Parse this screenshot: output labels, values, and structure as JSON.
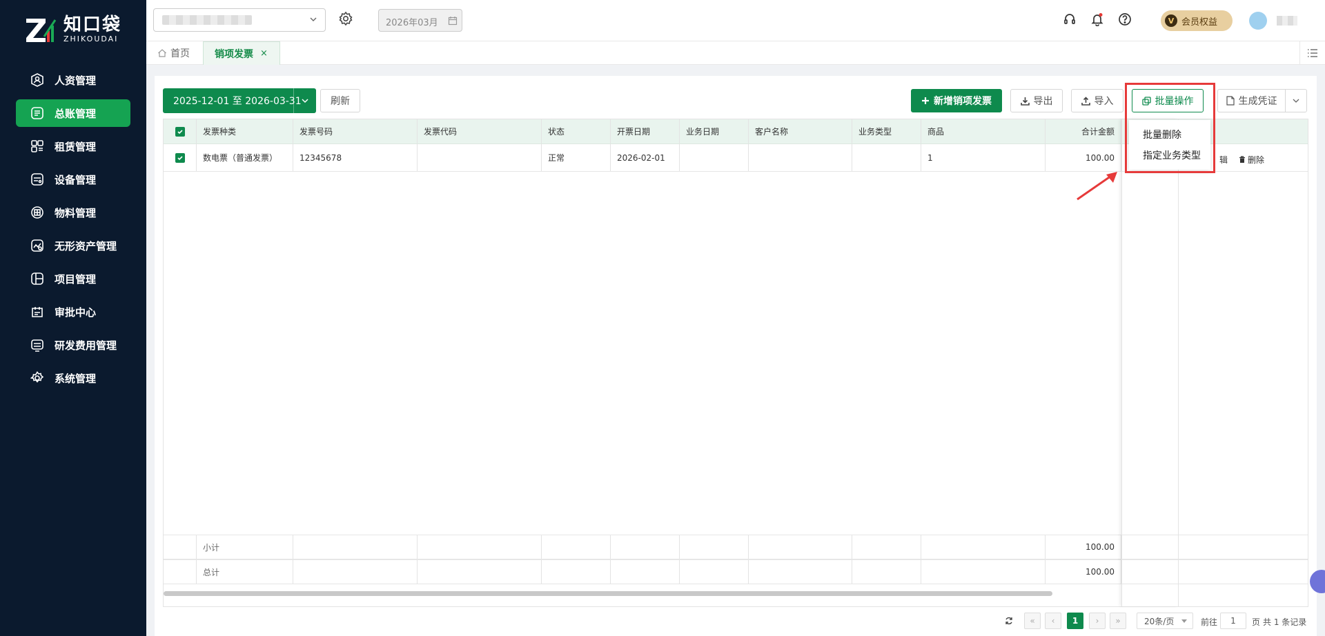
{
  "logo": {
    "cn": "知口袋",
    "en": "ZHIKOUDAI"
  },
  "sidebar": {
    "items": [
      {
        "label": "人资管理",
        "icon": "user-circle-icon",
        "active": false
      },
      {
        "label": "总账管理",
        "icon": "ledger-icon",
        "active": true
      },
      {
        "label": "租赁管理",
        "icon": "lease-icon",
        "active": false
      },
      {
        "label": "设备管理",
        "icon": "device-icon",
        "active": false
      },
      {
        "label": "物料管理",
        "icon": "material-icon",
        "active": false
      },
      {
        "label": "无形资产管理",
        "icon": "intangible-asset-icon",
        "active": false
      },
      {
        "label": "项目管理",
        "icon": "project-icon",
        "active": false
      },
      {
        "label": "审批中心",
        "icon": "approval-icon",
        "active": false
      },
      {
        "label": "研发费用管理",
        "icon": "rd-expense-icon",
        "active": false
      },
      {
        "label": "系统管理",
        "icon": "gear-icon",
        "active": false
      }
    ]
  },
  "topbar": {
    "period": "2026年03月",
    "vip_label": "会员权益",
    "vip_badge": "V"
  },
  "tabs": {
    "home": "首页",
    "active": "销项发票",
    "close": "×"
  },
  "toolbar": {
    "date_range": "2025-12-01 至 2026-03-31",
    "refresh": "刷新",
    "add": "新增销项发票",
    "export": "导出",
    "import": "导入",
    "batch": "批量操作",
    "voucher": "生成凭证"
  },
  "dropdown": {
    "items": [
      "批量删除",
      "指定业务类型"
    ]
  },
  "table": {
    "columns": [
      "发票种类",
      "发票号码",
      "发票代码",
      "状态",
      "开票日期",
      "业务日期",
      "客户名称",
      "业务类型",
      "商品",
      "合计金额"
    ],
    "rows": [
      {
        "type": "数电票（普通发票）",
        "number": "12345678",
        "code": "",
        "status": "正常",
        "issue_date": "2026-02-01",
        "biz_date": "",
        "customer": "",
        "biz_type": "",
        "goods": "1",
        "total": "100.00"
      }
    ],
    "actions": {
      "delete": "删除",
      "edit_partial": "辑"
    },
    "subtotal_label": "小计",
    "subtotal_value": "100.00",
    "total_label": "总计",
    "total_value": "100.00"
  },
  "pager": {
    "current": "1",
    "page_size": "20条/页",
    "goto_label": "前往",
    "goto_value": "1",
    "page_unit": "页",
    "summary": "共 1 条记录"
  },
  "colors": {
    "brand": "#0e8a4d",
    "sidebar_bg": "#0b1a2e",
    "sidebar_active": "#15a352",
    "highlight": "#e63a3a"
  }
}
